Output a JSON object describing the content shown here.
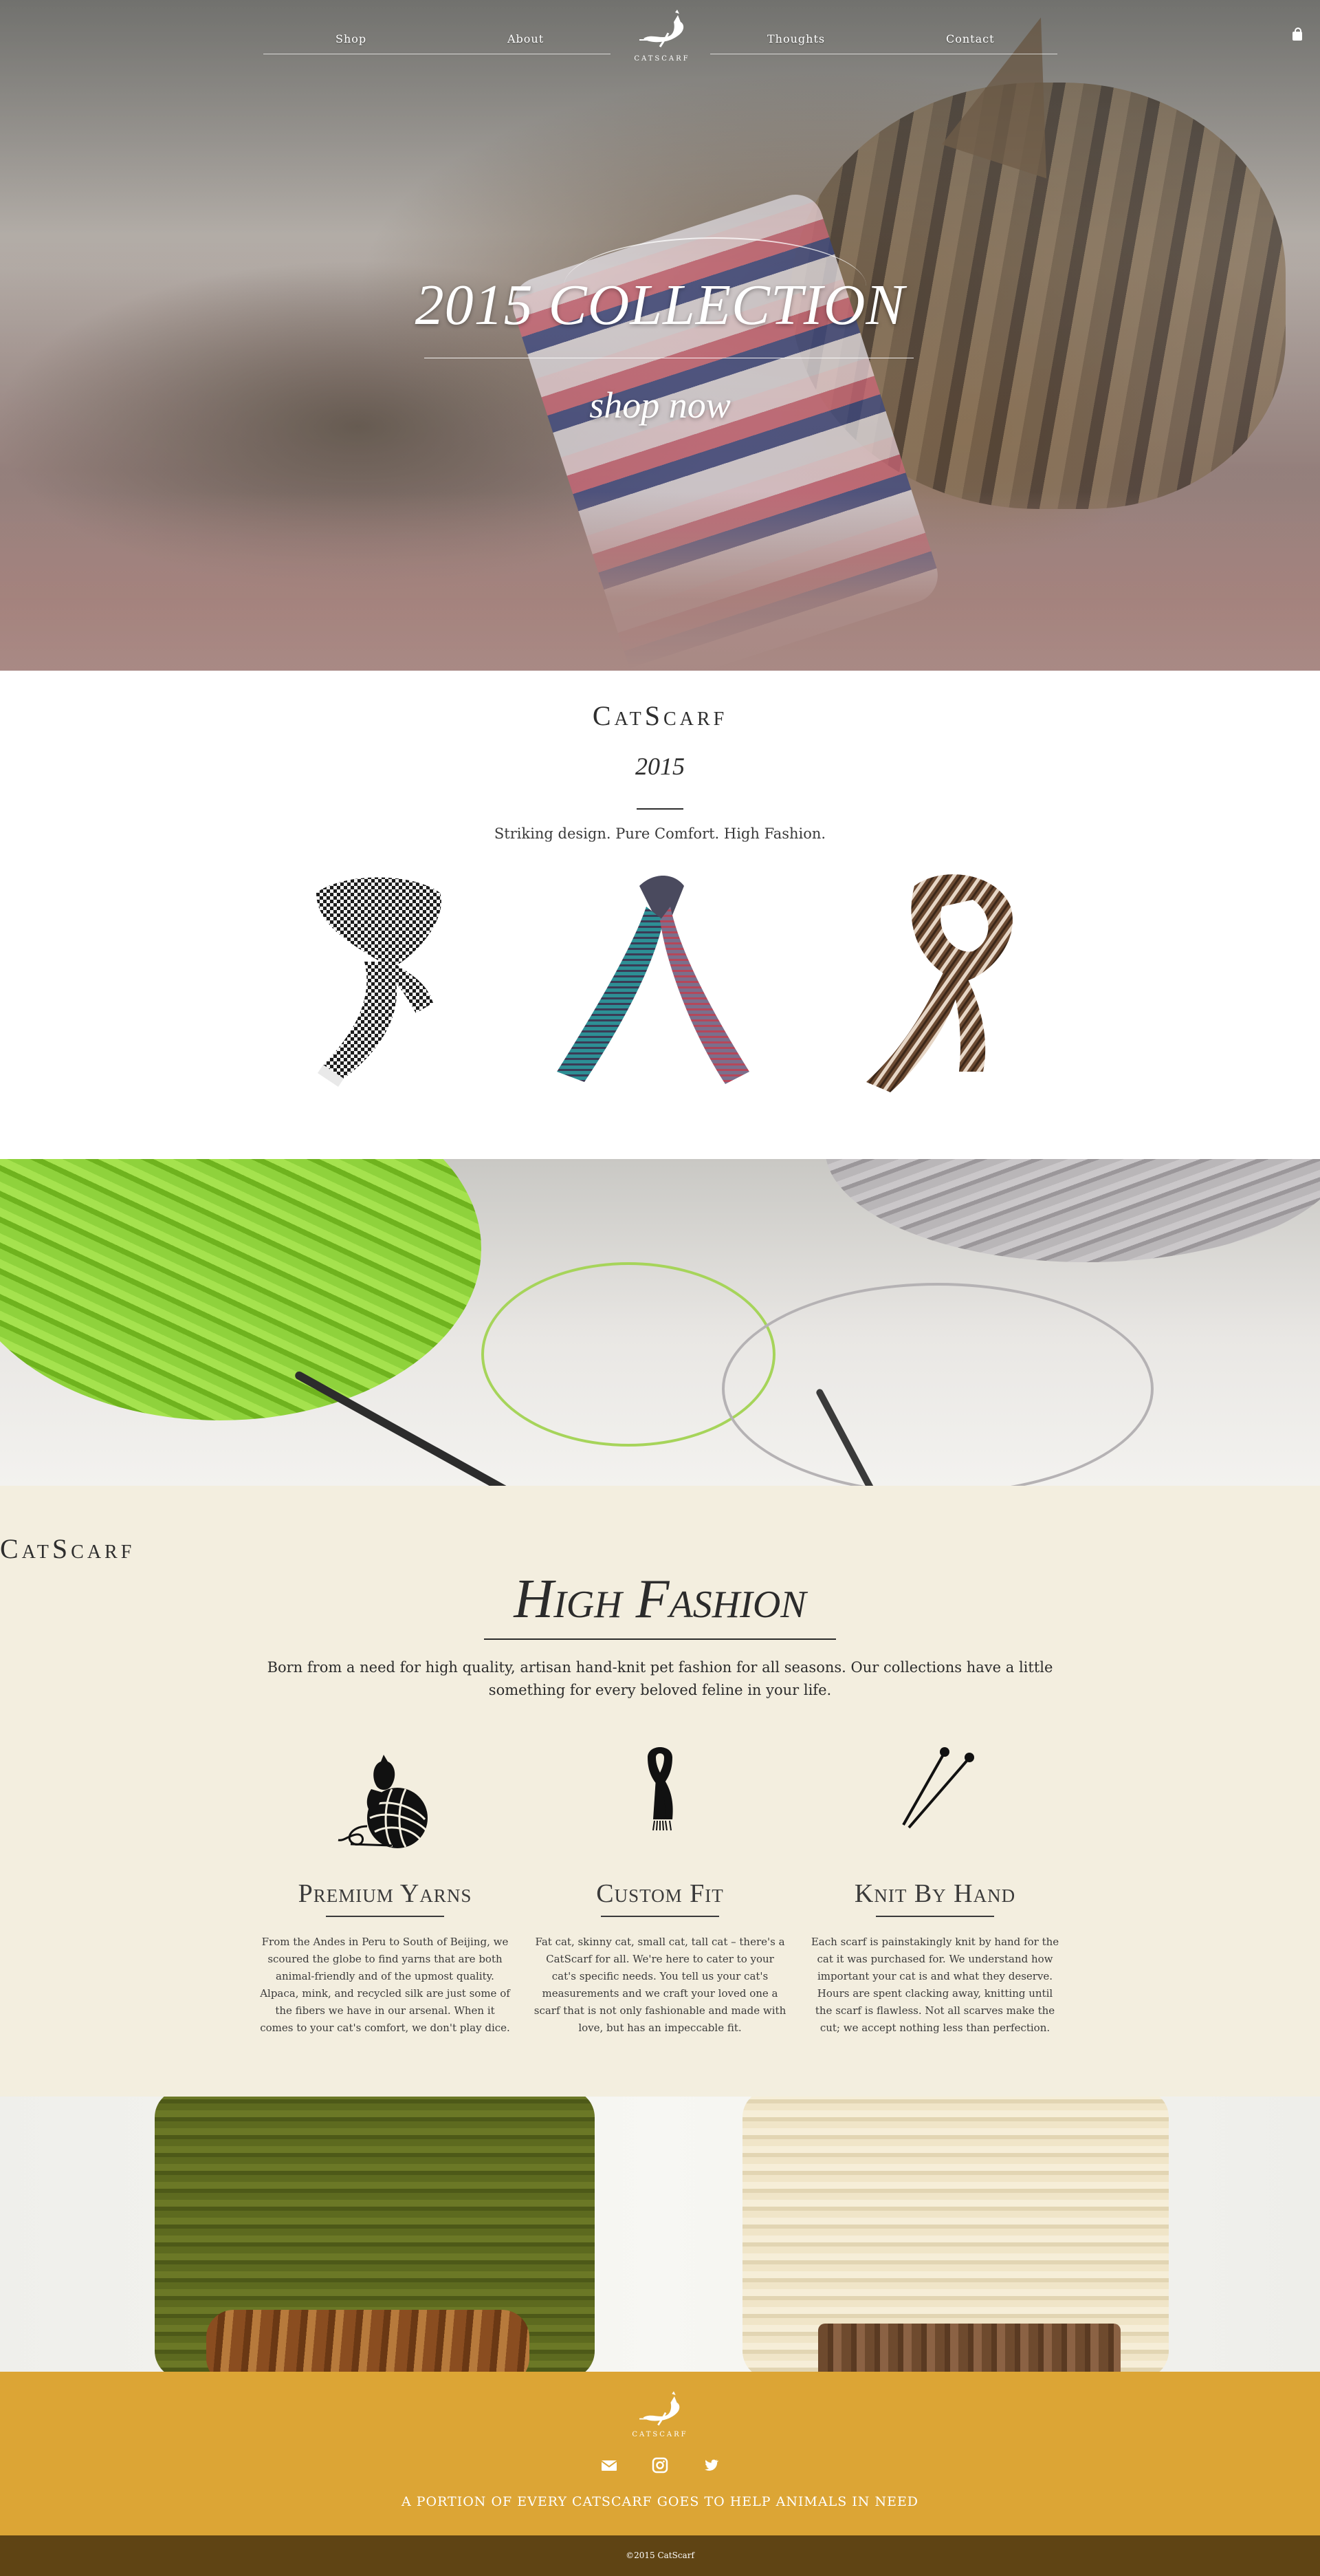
{
  "nav": {
    "items": [
      "Shop",
      "About",
      "Thoughts",
      "Contact"
    ],
    "logo_text": "CATSCARF"
  },
  "hero": {
    "title": "2015 COLLECTION",
    "cta": "shop now"
  },
  "intro": {
    "brand": "CatScarf",
    "year": "2015",
    "tagline": "Striking design. Pure Comfort. High Fashion."
  },
  "fashion": {
    "brand": "CatScarf",
    "title": "High Fashion",
    "description": "Born from a need for high quality, artisan hand-knit pet fashion for all seasons. Our collections have a little something for every beloved feline in your life.",
    "features": [
      {
        "icon": "yarn-ball-cat-icon",
        "title": "Premium Yarns",
        "text": "From the Andes in Peru to South of Beijing, we scoured the globe to find yarns that are both animal-friendly and of the upmost quality. Alpaca, mink, and recycled silk are just some of the fibers we have in our arsenal. When it comes to your cat's comfort, we don't play dice."
      },
      {
        "icon": "scarf-icon",
        "title": "Custom Fit",
        "text": "Fat cat, skinny cat, small cat, tall cat – there's a CatScarf for all. We're here to cater to your cat's specific needs. You tell us your cat's measurements and we craft your loved one a scarf that is not only fashionable and made with love, but has an impeccable fit."
      },
      {
        "icon": "knitting-needles-icon",
        "title": "Knit By Hand",
        "text": "Each scarf is painstakingly knit by hand for the cat it was purchased for. We understand how important your cat is and what they deserve. Hours are spent clacking away, knitting until the scarf is flawless. Not all scarves make the cut; we accept nothing less than perfection."
      }
    ]
  },
  "footer": {
    "logo_text": "CATSCARF",
    "social": [
      "envelope-icon",
      "instagram-icon",
      "twitter-icon"
    ],
    "mission": "A portion of every CatScarf goes to help animals in need",
    "copyright": "©2015 CatScarf"
  },
  "colors": {
    "cream": "#f3eedf",
    "mustard": "#dca535",
    "brown": "#5f4414"
  }
}
